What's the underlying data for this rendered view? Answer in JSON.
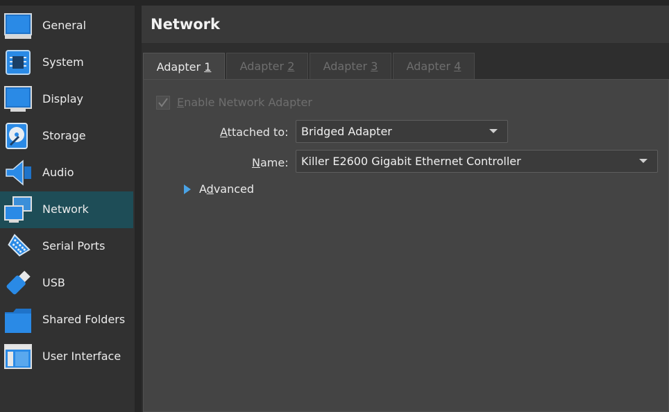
{
  "sidebar": {
    "items": [
      {
        "label": "General",
        "icon": "general-icon"
      },
      {
        "label": "System",
        "icon": "system-chip-icon"
      },
      {
        "label": "Display",
        "icon": "display-monitor-icon"
      },
      {
        "label": "Storage",
        "icon": "storage-disk-icon"
      },
      {
        "label": "Audio",
        "icon": "audio-speaker-icon"
      },
      {
        "label": "Network",
        "icon": "network-icon",
        "selected": true
      },
      {
        "label": "Serial Ports",
        "icon": "serial-port-icon"
      },
      {
        "label": "USB",
        "icon": "usb-icon"
      },
      {
        "label": "Shared Folders",
        "icon": "folder-icon"
      },
      {
        "label": "User Interface",
        "icon": "user-interface-icon"
      }
    ]
  },
  "header": {
    "title": "Network"
  },
  "tabs": [
    {
      "prefix": "Adapter ",
      "mnemonic": "1",
      "active": true
    },
    {
      "prefix": "Adapter ",
      "mnemonic": "2",
      "active": false
    },
    {
      "prefix": "Adapter ",
      "mnemonic": "3",
      "active": false
    },
    {
      "prefix": "Adapter ",
      "mnemonic": "4",
      "active": false
    }
  ],
  "adapter": {
    "enable_mnemonic": "E",
    "enable_rest": "nable Network Adapter",
    "enable_checked": true,
    "enable_disabled": true,
    "attached_mnemonic": "A",
    "attached_rest": "ttached to:",
    "attached_value": "Bridged Adapter",
    "name_mnemonic": "N",
    "name_rest": "ame:",
    "name_value": "Killer E2600 Gigabit Ethernet Controller",
    "advanced_first": "A",
    "advanced_mnemonic": "d",
    "advanced_rest": "vanced"
  },
  "colors": {
    "selection": "#1e4d57",
    "accent_arrow": "#4aa3e6"
  }
}
